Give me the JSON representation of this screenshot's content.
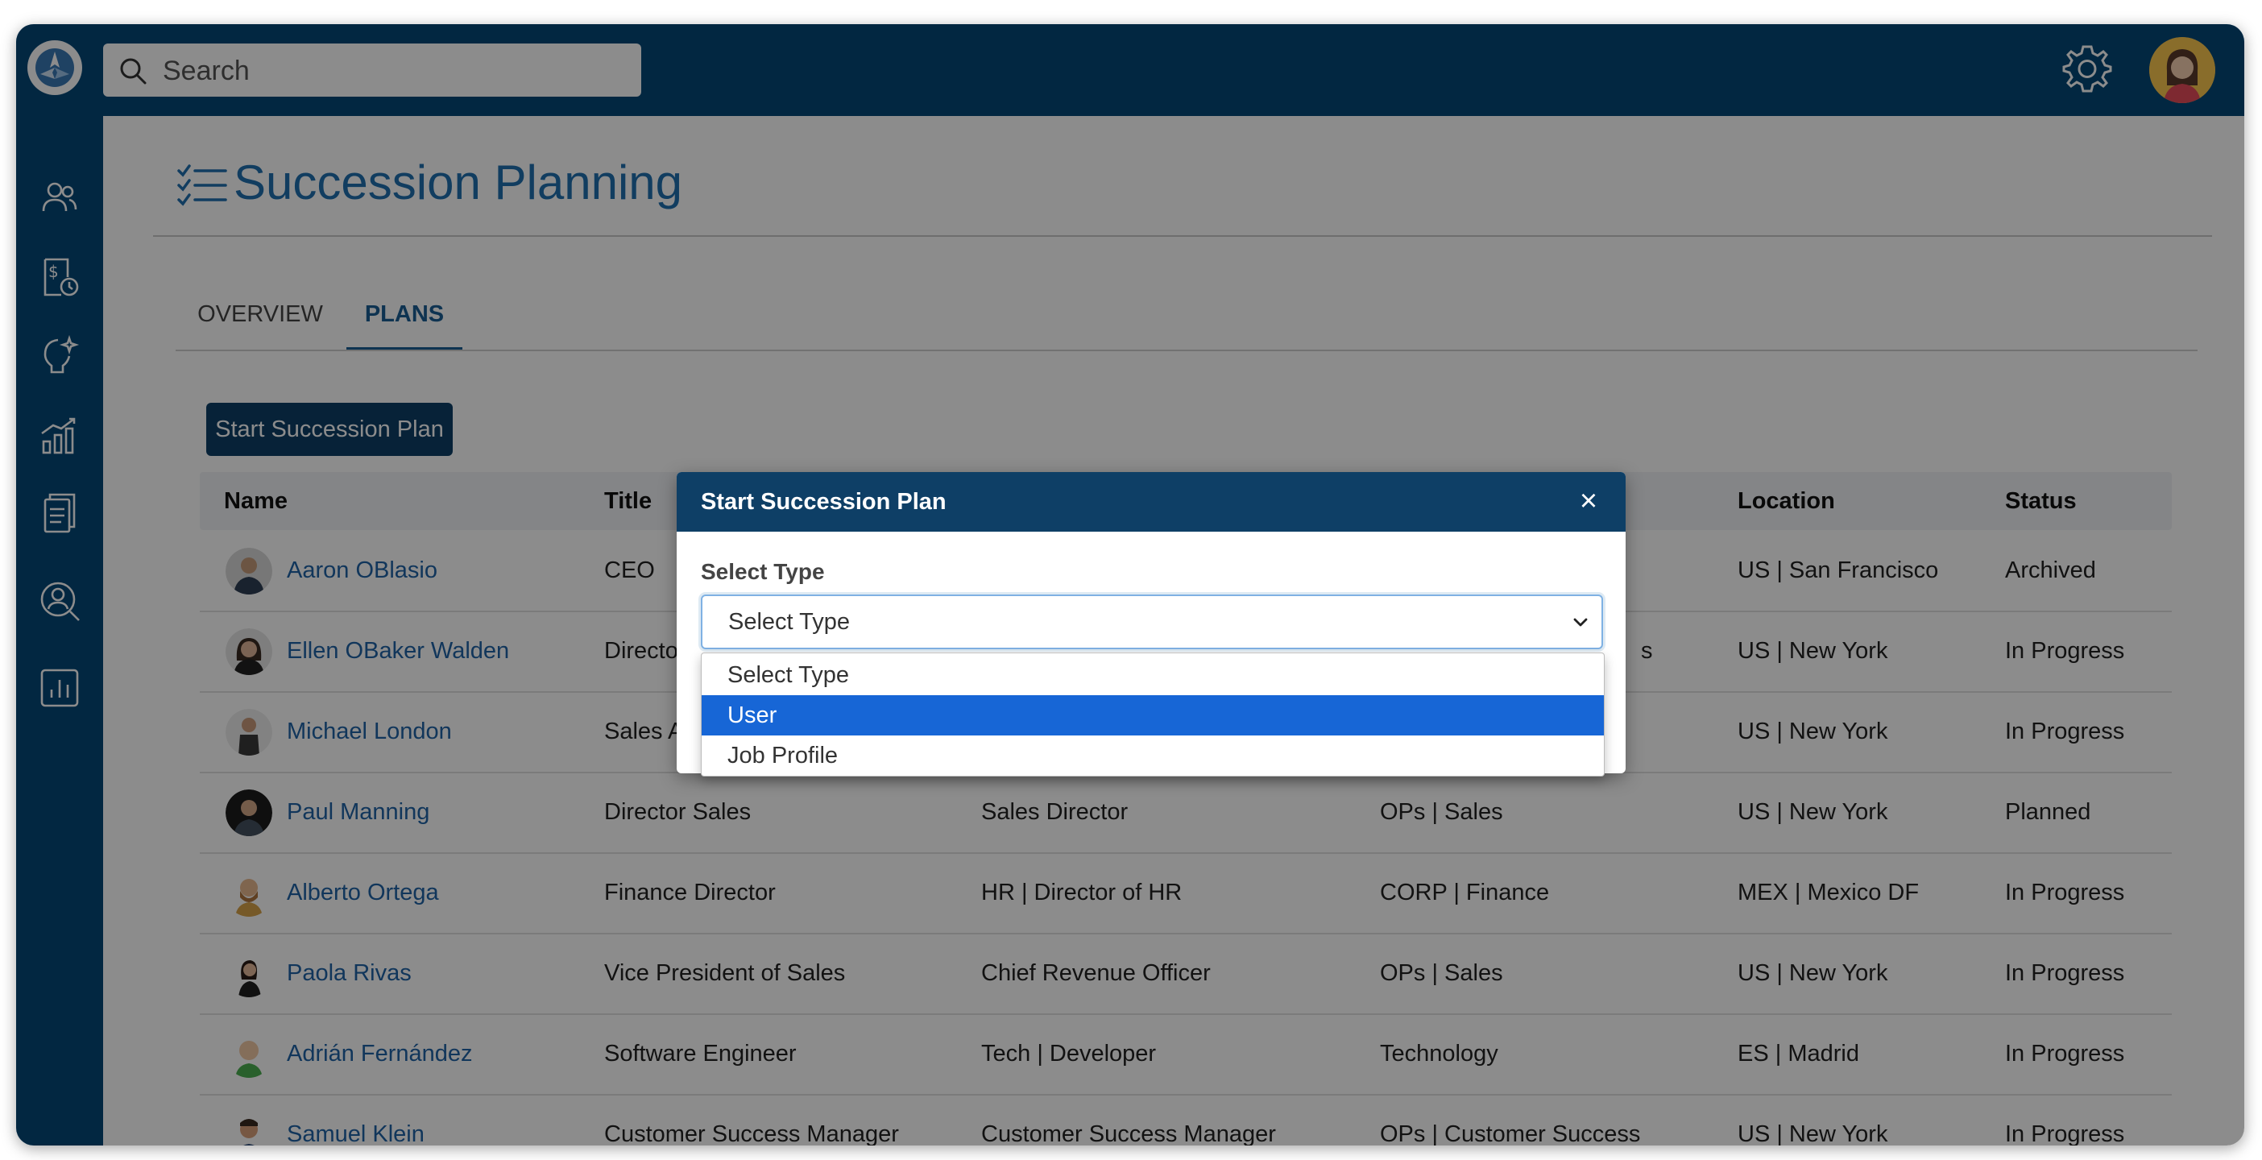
{
  "search": {
    "placeholder": "Search"
  },
  "page": {
    "title": "Succession Planning"
  },
  "tabs": [
    {
      "label": "OVERVIEW",
      "active": false
    },
    {
      "label": "PLANS",
      "active": true
    }
  ],
  "actions": {
    "start_plan": "Start Succession Plan"
  },
  "table": {
    "headers": [
      "Name",
      "Title",
      "Location",
      "Status"
    ],
    "rows": [
      {
        "name": "Aaron OBlasio",
        "title": "CEO",
        "position": "",
        "org": "",
        "location": "US | San Francisco",
        "status": "Archived"
      },
      {
        "name": "Ellen OBaker Walden",
        "title": "Directo",
        "position": "",
        "org": "s",
        "location": "US | New York",
        "status": "In Progress"
      },
      {
        "name": "Michael London",
        "title": "Sales A",
        "position": "",
        "org": "",
        "location": "US | New York",
        "status": "In Progress"
      },
      {
        "name": "Paul Manning",
        "title": "Director Sales",
        "position": "Sales Director",
        "org": "OPs | Sales",
        "location": "US | New York",
        "status": "Planned"
      },
      {
        "name": "Alberto Ortega",
        "title": "Finance Director",
        "position": "HR | Director of HR",
        "org": "CORP | Finance",
        "location": "MEX | Mexico DF",
        "status": "In Progress"
      },
      {
        "name": "Paola Rivas",
        "title": "Vice President of Sales",
        "position": "Chief Revenue Officer",
        "org": "OPs | Sales",
        "location": "US | New York",
        "status": "In Progress"
      },
      {
        "name": "Adrián Fernández",
        "title": "Software Engineer",
        "position": "Tech | Developer",
        "org": "Technology",
        "location": "ES | Madrid",
        "status": "In Progress"
      },
      {
        "name": "Samuel Klein",
        "title": "Customer Success Manager",
        "position": "Customer Success Manager",
        "org": "OPs | Customer Success",
        "location": "US | New York",
        "status": "In Progress"
      }
    ]
  },
  "modal": {
    "title": "Start Succession Plan",
    "close": "×",
    "field_label": "Select Type",
    "select_value": "Select Type",
    "options": [
      "Select Type",
      "User",
      "Job Profile"
    ],
    "highlighted_option": "User"
  },
  "colors": {
    "brand": "#054777",
    "accent": "#1f6fb0",
    "button": "#0e3f66",
    "highlight": "#1766d6"
  },
  "icons": {
    "sidebar": [
      "people-icon",
      "compensation-icon",
      "ideas-icon",
      "growth-chart-icon",
      "documents-icon",
      "talent-search-icon",
      "analytics-icon"
    ],
    "topbar": [
      "app-logo-icon",
      "search-icon",
      "gear-icon",
      "user-avatar"
    ]
  }
}
